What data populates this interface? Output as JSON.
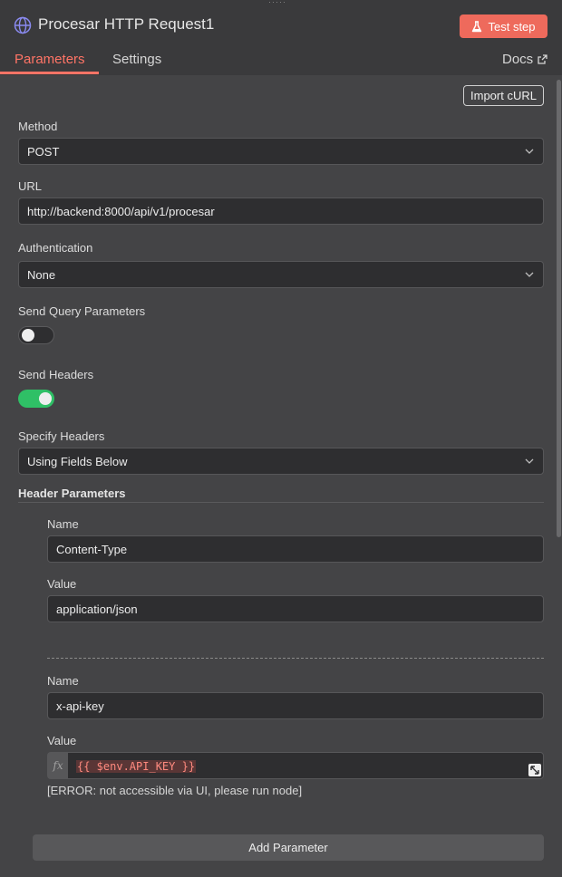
{
  "header": {
    "title": "Procesar HTTP Request1",
    "test_step_label": "Test step",
    "tabs": [
      {
        "label": "Parameters"
      },
      {
        "label": "Settings"
      }
    ],
    "docs_label": "Docs"
  },
  "import_curl_label": "Import cURL",
  "method": {
    "label": "Method",
    "value": "POST"
  },
  "url": {
    "label": "URL",
    "value": "http://backend:8000/api/v1/procesar"
  },
  "authentication": {
    "label": "Authentication",
    "value": "None"
  },
  "send_query_parameters": {
    "label": "Send Query Parameters",
    "enabled": false
  },
  "send_headers": {
    "label": "Send Headers",
    "enabled": true
  },
  "specify_headers": {
    "label": "Specify Headers",
    "value": "Using Fields Below"
  },
  "header_parameters": {
    "title": "Header Parameters",
    "items": [
      {
        "name_label": "Name",
        "name": "Content-Type",
        "value_label": "Value",
        "value": "application/json"
      },
      {
        "name_label": "Name",
        "name": "x-api-key",
        "value_label": "Value",
        "value": "{{ $env.API_KEY }}",
        "error": "[ERROR: not accessible via UI, please run node]"
      }
    ],
    "add_label": "Add Parameter"
  },
  "colors": {
    "accent": "#ff7466",
    "toggle_on": "#2fc066",
    "button": "#ee6a5c"
  },
  "icons": {
    "node": "globe-icon",
    "test": "flask-icon",
    "docs": "external-link-icon",
    "select": "chevron-down-icon",
    "expand": "expand-icon"
  }
}
